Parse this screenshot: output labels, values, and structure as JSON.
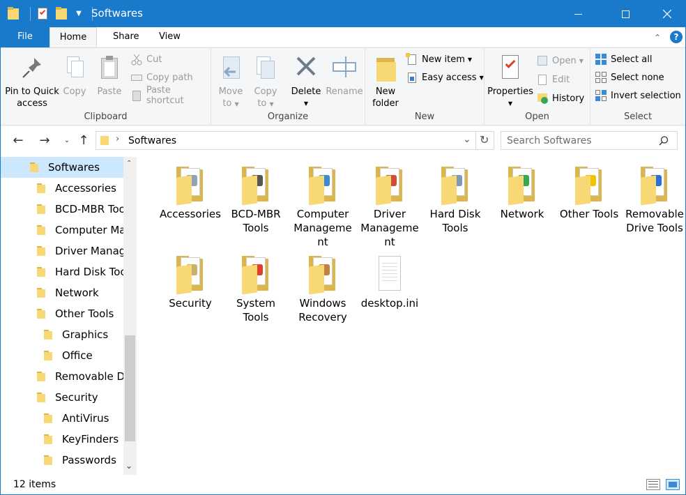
{
  "window": {
    "title": "Softwares",
    "colors": {
      "titlebar": "#1979ca",
      "selection": "#cce8ff",
      "folder": "#f8d775"
    }
  },
  "ribbon_tabs": {
    "file": "File",
    "home": "Home",
    "share": "Share",
    "view": "View"
  },
  "ribbon": {
    "clipboard": {
      "label": "Clipboard",
      "pin_line1": "Pin to Quick",
      "pin_line2": "access",
      "copy": "Copy",
      "paste": "Paste",
      "cut": "Cut",
      "copy_path": "Copy path",
      "paste_shortcut": "Paste shortcut"
    },
    "organize": {
      "label": "Organize",
      "move_line1": "Move",
      "move_line2": "to",
      "copy_line1": "Copy",
      "copy_line2": "to",
      "delete": "Delete",
      "rename": "Rename"
    },
    "new": {
      "label": "New",
      "new_item": "New item",
      "easy_access": "Easy access",
      "folder_line1": "New",
      "folder_line2": "folder"
    },
    "open": {
      "label": "Open",
      "properties": "Properties",
      "open": "Open",
      "edit": "Edit",
      "history": "History"
    },
    "select": {
      "label": "Select",
      "select_all": "Select all",
      "select_none": "Select none",
      "invert": "Invert selection"
    }
  },
  "address": {
    "path": "Softwares",
    "search_placeholder": "Search Softwares"
  },
  "nav_tree": [
    {
      "label": "Softwares",
      "level": 0,
      "selected": true
    },
    {
      "label": "Accessories",
      "level": 1
    },
    {
      "label": "BCD-MBR Tools",
      "level": 1
    },
    {
      "label": "Computer Management",
      "level": 1
    },
    {
      "label": "Driver Management",
      "level": 1
    },
    {
      "label": "Hard Disk Tools",
      "level": 1
    },
    {
      "label": "Network",
      "level": 1
    },
    {
      "label": "Other Tools",
      "level": 1
    },
    {
      "label": "Graphics",
      "level": 2
    },
    {
      "label": "Office",
      "level": 2
    },
    {
      "label": "Removable Drive Tools",
      "level": 1
    },
    {
      "label": "Security",
      "level": 1
    },
    {
      "label": "AntiVirus",
      "level": 2
    },
    {
      "label": "KeyFinders",
      "level": 2
    },
    {
      "label": "Passwords",
      "level": 2
    }
  ],
  "items": [
    {
      "line1": "Accessories",
      "line2": "",
      "line3": "",
      "icon": "folder-accessories-icon"
    },
    {
      "line1": "BCD-MBR",
      "line2": "Tools",
      "line3": "",
      "icon": "folder-bcd-icon"
    },
    {
      "line1": "Computer",
      "line2": "Manageme",
      "line3": "nt",
      "icon": "folder-computer-icon"
    },
    {
      "line1": "Driver",
      "line2": "Manageme",
      "line3": "nt",
      "icon": "folder-driver-icon"
    },
    {
      "line1": "Hard Disk",
      "line2": "Tools",
      "line3": "",
      "icon": "folder-harddisk-icon"
    },
    {
      "line1": "Network",
      "line2": "",
      "line3": "",
      "icon": "folder-network-icon"
    },
    {
      "line1": "Other Tools",
      "line2": "",
      "line3": "",
      "icon": "folder-othertools-icon"
    },
    {
      "line1": "Removable",
      "line2": "Drive Tools",
      "line3": "",
      "icon": "folder-removable-icon"
    },
    {
      "line1": "Security",
      "line2": "",
      "line3": "",
      "icon": "folder-security-icon"
    },
    {
      "line1": "System",
      "line2": "Tools",
      "line3": "",
      "icon": "folder-system-icon"
    },
    {
      "line1": "Windows",
      "line2": "Recovery",
      "line3": "",
      "icon": "folder-recovery-icon"
    },
    {
      "line1": "desktop.ini",
      "line2": "",
      "line3": "",
      "icon": "ini-file-icon"
    }
  ],
  "status": {
    "count": "12 items"
  }
}
